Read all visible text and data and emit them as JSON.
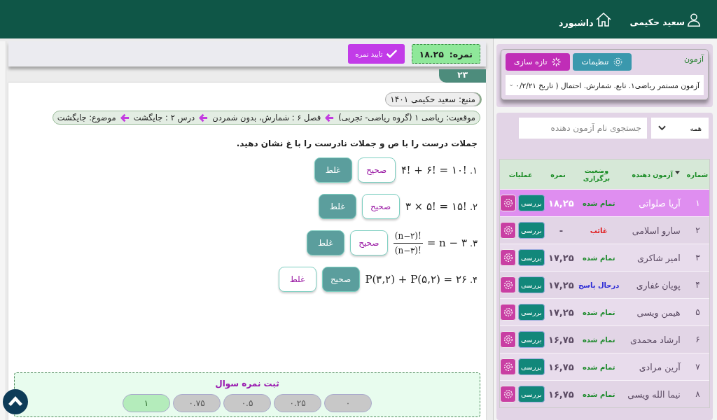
{
  "header": {
    "user": "سعید حکیمی",
    "dashboard": "داشبورد"
  },
  "grading": {
    "score_label": "نمره:",
    "score": "۱۸.۲۵",
    "confirm": "تایید نمره"
  },
  "question": {
    "number": "۲۳",
    "source": "منبع: سعید حکیمی ۱۴۰۱",
    "location": [
      "موقعیت: ریاضی ۱ (گروه ریاضی- تجربی)",
      "فصل ۶ : شمارش، بدون شمردن",
      "درس ۲ : جایگشت",
      "موضوع: جایگشت"
    ],
    "prompt": "جملات درست را با ص و جملات نادرست را با غ نشان دهید.",
    "statements": [
      {
        "number": "۱.",
        "kind": "text",
        "expression": "۴! + ۶! = ۱۰!",
        "options": [
          {
            "label": "صحیح",
            "selected": false
          },
          {
            "label": "غلط",
            "selected": true
          }
        ]
      },
      {
        "number": "۲.",
        "kind": "text",
        "expression": "۳ × ۵! = ۱۵!",
        "options": [
          {
            "label": "صحیح",
            "selected": false
          },
          {
            "label": "غلط",
            "selected": true
          }
        ]
      },
      {
        "number": "۳.",
        "kind": "fraction",
        "numerator": "(n−۲)!",
        "denominator": "(n−۳)!",
        "expression": "= n − ۳",
        "options": [
          {
            "label": "صحیح",
            "selected": false
          },
          {
            "label": "غلط",
            "selected": true
          }
        ]
      },
      {
        "number": "۴.",
        "kind": "text",
        "expression": "P(۳,۲) + P(۵,۲) = ۲۶",
        "options": [
          {
            "label": "صحیح",
            "selected": true
          },
          {
            "label": "غلط",
            "selected": false
          }
        ]
      }
    ],
    "score_panel": {
      "title": "ثبت نمره سوال",
      "options": [
        {
          "label": "۰",
          "selected": false
        },
        {
          "label": "۰.۲۵",
          "selected": false
        },
        {
          "label": "۰.۵",
          "selected": false
        },
        {
          "label": "۰.۷۵",
          "selected": false
        },
        {
          "label": "۱",
          "selected": true
        }
      ]
    }
  },
  "exam": {
    "label": "آزمون",
    "settings": "تنظیمات",
    "refresh": "تازه سازی",
    "selected_exam": "آزمون مستمر ریاضی۱. تابع. شمارش. احتمال ( تاریخ ۰/۲/۲۱"
  },
  "filter": {
    "value": "همه",
    "placeholder": "جستجوی نام آزمون دهنده"
  },
  "table": {
    "columns": [
      "شماره",
      "آزمون دهنده",
      "وضعیت برگزاری",
      "نمره",
      "عملیات"
    ],
    "rows": [
      {
        "number": "۱",
        "name": "آریا صلواتی",
        "status": "تمام شده",
        "color": "#1b8a2a",
        "score": "۱۸,۲۵",
        "action": "بررسی",
        "selected": true
      },
      {
        "number": "۲",
        "name": "سارو اسلامی",
        "status": "غائب",
        "color": "#e0191b",
        "score": "-",
        "action": "بررسی",
        "selected": false
      },
      {
        "number": "۳",
        "name": "امیر شاکری",
        "status": "تمام شده",
        "color": "#1b8a2a",
        "score": "۱۷,۲۵",
        "action": "بررسی",
        "selected": false
      },
      {
        "number": "۴",
        "name": "پویان غفاری",
        "status": "درحال پاسخ",
        "color": "#2b2bd6",
        "score": "۱۷,۲۵",
        "action": "بررسی",
        "selected": false
      },
      {
        "number": "۵",
        "name": "هیمن ویسی",
        "status": "تمام شده",
        "color": "#1b8a2a",
        "score": "۱۷,۲۵",
        "action": "بررسی",
        "selected": false
      },
      {
        "number": "۶",
        "name": "ارشاد محمدی",
        "status": "تمام شده",
        "color": "#1b8a2a",
        "score": "۱۶,۷۵",
        "action": "بررسی",
        "selected": false
      },
      {
        "number": "۷",
        "name": "آرین مرادی",
        "status": "تمام شده",
        "color": "#1b8a2a",
        "score": "۱۶,۷۵",
        "action": "بررسی",
        "selected": false
      },
      {
        "number": "۸",
        "name": "نیما الله ویسی",
        "status": "تمام شده",
        "color": "#1b8a2a",
        "score": "۱۶,۷۵",
        "action": "بررسی",
        "selected": false
      }
    ]
  }
}
